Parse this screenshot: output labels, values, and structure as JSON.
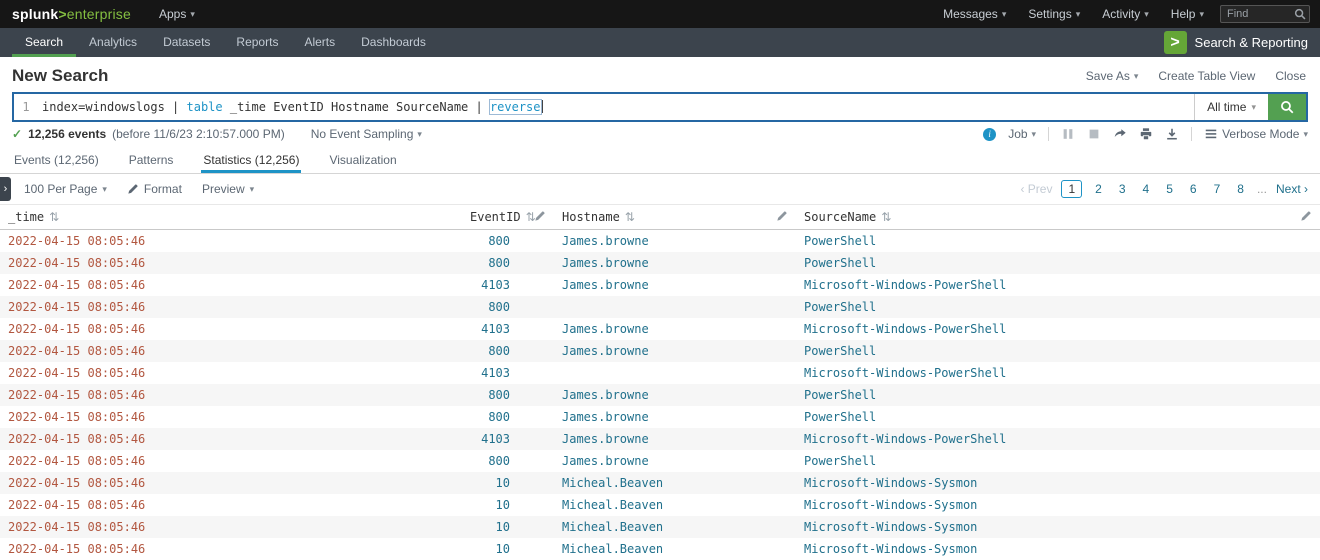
{
  "colors": {
    "accent": "#1e93c6",
    "green": "#53a051",
    "icon_green": "#65a637",
    "logo_green": "#84bf41",
    "value": "#20708c",
    "time_value": "#b25740",
    "link": "#20708c",
    "search_border": "#2567a3"
  },
  "icons": {
    "caret": "▾",
    "check": "✓",
    "sort": "⇅",
    "chevron_right": "›",
    "info": "i",
    "app_gt": ">"
  },
  "topbar": {
    "logo_splunk": "splunk",
    "logo_gt": ">",
    "logo_product": "enterprise",
    "apps_menu": "Apps",
    "menus": [
      "Messages",
      "Settings",
      "Activity",
      "Help"
    ],
    "find_placeholder": "Find"
  },
  "appbar": {
    "tabs": [
      {
        "label": "Search",
        "active": true
      },
      {
        "label": "Analytics",
        "active": false
      },
      {
        "label": "Datasets",
        "active": false
      },
      {
        "label": "Reports",
        "active": false
      },
      {
        "label": "Alerts",
        "active": false
      },
      {
        "label": "Dashboards",
        "active": false
      }
    ],
    "app_name": "Search & Reporting"
  },
  "page_header": {
    "title": "New Search",
    "save_as": "Save As",
    "create_table_view": "Create Table View",
    "close": "Close"
  },
  "search_bar": {
    "line_number": "1",
    "query": [
      {
        "text": "index=windowslogs | ",
        "style": "plain"
      },
      {
        "text": "table",
        "style": "command"
      },
      {
        "text": " _time EventID Hostname SourceName | ",
        "style": "plain"
      },
      {
        "text": "reverse",
        "style": "command-active"
      }
    ],
    "time_range_label": "All time"
  },
  "job_bar": {
    "events_count": "12,256 events",
    "events_suffix": "(before 11/6/23 2:10:57.000 PM)",
    "sampling_label": "No Event Sampling",
    "job_label": "Job",
    "mode_label": "Verbose Mode"
  },
  "result_tabs": [
    {
      "label": "Events (12,256)",
      "active": false
    },
    {
      "label": "Patterns",
      "active": false
    },
    {
      "label": "Statistics (12,256)",
      "active": true
    },
    {
      "label": "Visualization",
      "active": false
    }
  ],
  "results_toolbar": {
    "per_page_label": "100 Per Page",
    "format_label": "Format",
    "preview_label": "Preview",
    "pagination": {
      "prev": "‹ Prev",
      "pages": [
        "1",
        "2",
        "3",
        "4",
        "5",
        "6",
        "7",
        "8"
      ],
      "active_page": "1",
      "ellipsis": "...",
      "next": "Next ›"
    }
  },
  "table": {
    "columns": [
      {
        "key": "time",
        "label": "_time",
        "align": "left",
        "editable": false
      },
      {
        "key": "eventid",
        "label": "EventID",
        "align": "right",
        "editable": true
      },
      {
        "key": "hostname",
        "label": "Hostname",
        "align": "left",
        "editable": true
      },
      {
        "key": "sourcename",
        "label": "SourceName",
        "align": "left",
        "editable": true
      }
    ],
    "rows": [
      [
        "2022-04-15 08:05:46",
        "800",
        "James.browne",
        "PowerShell"
      ],
      [
        "2022-04-15 08:05:46",
        "800",
        "James.browne",
        "PowerShell"
      ],
      [
        "2022-04-15 08:05:46",
        "4103",
        "James.browne",
        "Microsoft-Windows-PowerShell"
      ],
      [
        "2022-04-15 08:05:46",
        "800",
        "",
        "PowerShell"
      ],
      [
        "2022-04-15 08:05:46",
        "4103",
        "James.browne",
        "Microsoft-Windows-PowerShell"
      ],
      [
        "2022-04-15 08:05:46",
        "800",
        "James.browne",
        "PowerShell"
      ],
      [
        "2022-04-15 08:05:46",
        "4103",
        "",
        "Microsoft-Windows-PowerShell"
      ],
      [
        "2022-04-15 08:05:46",
        "800",
        "James.browne",
        "PowerShell"
      ],
      [
        "2022-04-15 08:05:46",
        "800",
        "James.browne",
        "PowerShell"
      ],
      [
        "2022-04-15 08:05:46",
        "4103",
        "James.browne",
        "Microsoft-Windows-PowerShell"
      ],
      [
        "2022-04-15 08:05:46",
        "800",
        "James.browne",
        "PowerShell"
      ],
      [
        "2022-04-15 08:05:46",
        "10",
        "Micheal.Beaven",
        "Microsoft-Windows-Sysmon"
      ],
      [
        "2022-04-15 08:05:46",
        "10",
        "Micheal.Beaven",
        "Microsoft-Windows-Sysmon"
      ],
      [
        "2022-04-15 08:05:46",
        "10",
        "Micheal.Beaven",
        "Microsoft-Windows-Sysmon"
      ],
      [
        "2022-04-15 08:05:46",
        "10",
        "Micheal.Beaven",
        "Microsoft-Windows-Sysmon"
      ]
    ]
  }
}
